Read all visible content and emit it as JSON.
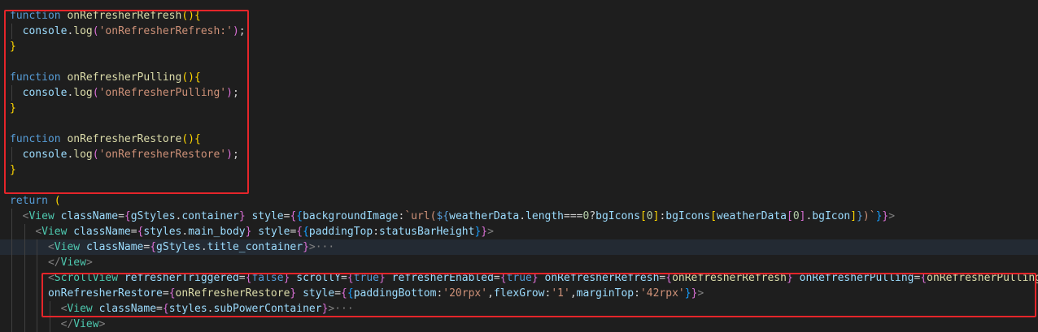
{
  "editor": {
    "lines": [
      [
        [
          "kw",
          "function"
        ],
        [
          "pun",
          " "
        ],
        [
          "fn",
          "onRefresherRefresh"
        ],
        [
          "br1",
          "("
        ],
        [
          "br1",
          ")"
        ],
        [
          "br1",
          "{"
        ]
      ],
      [
        [
          "pun",
          "  "
        ],
        [
          "var",
          "console"
        ],
        [
          "pun",
          "."
        ],
        [
          "fn",
          "log"
        ],
        [
          "br2",
          "("
        ],
        [
          "str",
          "'onRefresherRefresh:'"
        ],
        [
          "br2",
          ")"
        ],
        [
          "pun",
          ";"
        ]
      ],
      [
        [
          "br1",
          "}"
        ]
      ],
      [],
      [
        [
          "kw",
          "function"
        ],
        [
          "pun",
          " "
        ],
        [
          "fn",
          "onRefresherPulling"
        ],
        [
          "br1",
          "("
        ],
        [
          "br1",
          ")"
        ],
        [
          "br1",
          "{"
        ]
      ],
      [
        [
          "pun",
          "  "
        ],
        [
          "var",
          "console"
        ],
        [
          "pun",
          "."
        ],
        [
          "fn",
          "log"
        ],
        [
          "br2",
          "("
        ],
        [
          "str",
          "'onRefresherPulling'"
        ],
        [
          "br2",
          ")"
        ],
        [
          "pun",
          ";"
        ]
      ],
      [
        [
          "br1",
          "}"
        ]
      ],
      [],
      [
        [
          "kw",
          "function"
        ],
        [
          "pun",
          " "
        ],
        [
          "fn",
          "onRefresherRestore"
        ],
        [
          "br1",
          "("
        ],
        [
          "br1",
          ")"
        ],
        [
          "br1",
          "{"
        ]
      ],
      [
        [
          "pun",
          "  "
        ],
        [
          "var",
          "console"
        ],
        [
          "pun",
          "."
        ],
        [
          "fn",
          "log"
        ],
        [
          "br2",
          "("
        ],
        [
          "str",
          "'onRefresherRestore'"
        ],
        [
          "br2",
          ")"
        ],
        [
          "pun",
          ";"
        ]
      ],
      [
        [
          "br1",
          "}"
        ]
      ],
      [],
      [
        [
          "kw",
          "return"
        ],
        [
          "pun",
          " "
        ],
        [
          "br1",
          "("
        ]
      ],
      [
        [
          "pun",
          "  "
        ],
        [
          "ang",
          "<"
        ],
        [
          "tag",
          "View"
        ],
        [
          "pun",
          " "
        ],
        [
          "attr",
          "className"
        ],
        [
          "pun",
          "="
        ],
        [
          "br2",
          "{"
        ],
        [
          "var",
          "gStyles"
        ],
        [
          "pun",
          "."
        ],
        [
          "var",
          "container"
        ],
        [
          "br2",
          "}"
        ],
        [
          "pun",
          " "
        ],
        [
          "attr",
          "style"
        ],
        [
          "pun",
          "="
        ],
        [
          "br2",
          "{"
        ],
        [
          "br3",
          "{"
        ],
        [
          "var",
          "backgroundImage"
        ],
        [
          "pun",
          ":"
        ],
        [
          "str",
          "`url("
        ],
        [
          "kw",
          "${"
        ],
        [
          "var",
          "weatherData"
        ],
        [
          "pun",
          "."
        ],
        [
          "var",
          "length"
        ],
        [
          "pun",
          "==="
        ],
        [
          "num",
          "0"
        ],
        [
          "pun",
          "?"
        ],
        [
          "var",
          "bgIcons"
        ],
        [
          "br1",
          "["
        ],
        [
          "num",
          "0"
        ],
        [
          "br1",
          "]"
        ],
        [
          "pun",
          ":"
        ],
        [
          "var",
          "bgIcons"
        ],
        [
          "br1",
          "["
        ],
        [
          "var",
          "weatherData"
        ],
        [
          "br2",
          "["
        ],
        [
          "num",
          "0"
        ],
        [
          "br2",
          "]"
        ],
        [
          "pun",
          "."
        ],
        [
          "var",
          "bgIcon"
        ],
        [
          "br1",
          "]"
        ],
        [
          "kw",
          "}"
        ],
        [
          "str",
          ")`"
        ],
        [
          "br3",
          "}"
        ],
        [
          "br2",
          "}"
        ],
        [
          "ang",
          ">"
        ]
      ],
      [
        [
          "pun",
          "    "
        ],
        [
          "ang",
          "<"
        ],
        [
          "tag",
          "View"
        ],
        [
          "pun",
          " "
        ],
        [
          "attr",
          "className"
        ],
        [
          "pun",
          "="
        ],
        [
          "br2",
          "{"
        ],
        [
          "var",
          "styles"
        ],
        [
          "pun",
          "."
        ],
        [
          "var",
          "main_body"
        ],
        [
          "br2",
          "}"
        ],
        [
          "pun",
          " "
        ],
        [
          "attr",
          "style"
        ],
        [
          "pun",
          "="
        ],
        [
          "br2",
          "{"
        ],
        [
          "br3",
          "{"
        ],
        [
          "var",
          "paddingTop"
        ],
        [
          "pun",
          ":"
        ],
        [
          "var",
          "statusBarHeight"
        ],
        [
          "br3",
          "}"
        ],
        [
          "br2",
          "}"
        ],
        [
          "ang",
          ">"
        ]
      ],
      [
        [
          "pun",
          "      "
        ],
        [
          "ang",
          "<"
        ],
        [
          "tag",
          "View"
        ],
        [
          "pun",
          " "
        ],
        [
          "attr",
          "className"
        ],
        [
          "pun",
          "="
        ],
        [
          "br2",
          "{"
        ],
        [
          "var",
          "gStyles"
        ],
        [
          "pun",
          "."
        ],
        [
          "var",
          "title_container"
        ],
        [
          "br2",
          "}"
        ],
        [
          "ang",
          ">"
        ],
        [
          "fold",
          "···"
        ]
      ],
      [
        [
          "pun",
          "      "
        ],
        [
          "ang",
          "</"
        ],
        [
          "tag",
          "View"
        ],
        [
          "ang",
          ">"
        ]
      ],
      [
        [
          "pun",
          "      "
        ],
        [
          "ang",
          "<"
        ],
        [
          "tag",
          "ScrollView"
        ],
        [
          "pun",
          " "
        ],
        [
          "attr",
          "refresherTriggered"
        ],
        [
          "pun",
          "="
        ],
        [
          "br2",
          "{"
        ],
        [
          "kw",
          "false"
        ],
        [
          "br2",
          "}"
        ],
        [
          "pun",
          " "
        ],
        [
          "attr",
          "scrollY"
        ],
        [
          "pun",
          "="
        ],
        [
          "br2",
          "{"
        ],
        [
          "kw",
          "true"
        ],
        [
          "br2",
          "}"
        ],
        [
          "pun",
          " "
        ],
        [
          "attr",
          "refresherEnabled"
        ],
        [
          "pun",
          "="
        ],
        [
          "br2",
          "{"
        ],
        [
          "kw",
          "true"
        ],
        [
          "br2",
          "}"
        ],
        [
          "pun",
          " "
        ],
        [
          "attr",
          "onRefresherRefresh"
        ],
        [
          "pun",
          "="
        ],
        [
          "br2",
          "{"
        ],
        [
          "fn",
          "onRefresherRefresh"
        ],
        [
          "br2",
          "}"
        ],
        [
          "pun",
          " "
        ],
        [
          "attr",
          "onRefresherPulling"
        ],
        [
          "pun",
          "="
        ],
        [
          "br2",
          "{"
        ],
        [
          "fn",
          "onRefresherPulling"
        ],
        [
          "br2",
          "}"
        ]
      ],
      [
        [
          "pun",
          "      "
        ],
        [
          "attr",
          "onRefresherRestore"
        ],
        [
          "pun",
          "="
        ],
        [
          "br2",
          "{"
        ],
        [
          "fn",
          "onRefresherRestore"
        ],
        [
          "br2",
          "}"
        ],
        [
          "pun",
          " "
        ],
        [
          "attr",
          "style"
        ],
        [
          "pun",
          "="
        ],
        [
          "br2",
          "{"
        ],
        [
          "br3",
          "{"
        ],
        [
          "var",
          "paddingBottom"
        ],
        [
          "pun",
          ":"
        ],
        [
          "str",
          "'20rpx'"
        ],
        [
          "pun",
          ","
        ],
        [
          "var",
          "flexGrow"
        ],
        [
          "pun",
          ":"
        ],
        [
          "str",
          "'1'"
        ],
        [
          "pun",
          ","
        ],
        [
          "var",
          "marginTop"
        ],
        [
          "pun",
          ":"
        ],
        [
          "str",
          "'42rpx'"
        ],
        [
          "br3",
          "}"
        ],
        [
          "br2",
          "}"
        ],
        [
          "ang",
          ">"
        ]
      ],
      [
        [
          "pun",
          "        "
        ],
        [
          "ang",
          "<"
        ],
        [
          "tag",
          "View"
        ],
        [
          "pun",
          " "
        ],
        [
          "attr",
          "className"
        ],
        [
          "pun",
          "="
        ],
        [
          "br2",
          "{"
        ],
        [
          "var",
          "styles"
        ],
        [
          "pun",
          "."
        ],
        [
          "var",
          "subPowerContainer"
        ],
        [
          "br2",
          "}"
        ],
        [
          "ang",
          ">"
        ],
        [
          "fold",
          "···"
        ]
      ],
      [
        [
          "pun",
          "        "
        ],
        [
          "ang",
          "</"
        ],
        [
          "tag",
          "View"
        ],
        [
          "ang",
          ">"
        ]
      ]
    ],
    "colors": {
      "background": "#1e1e1e",
      "highlight_box": "#e5252a"
    }
  }
}
